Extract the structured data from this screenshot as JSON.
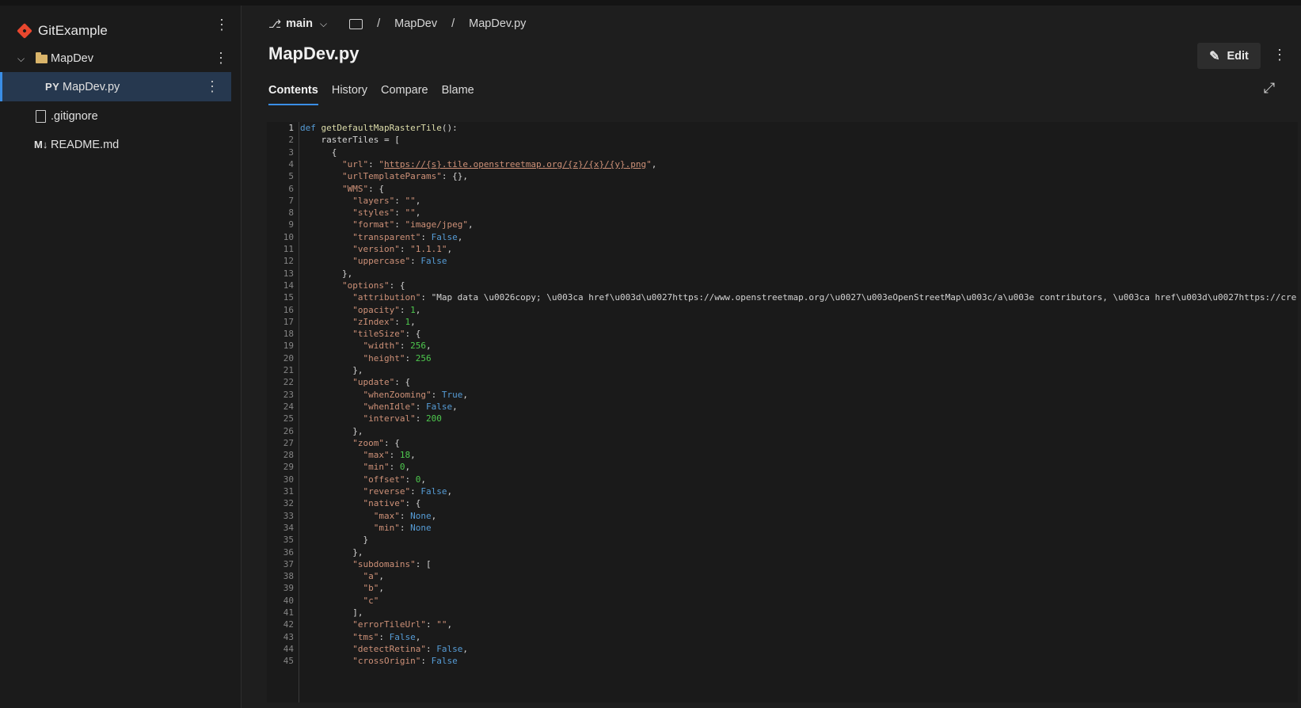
{
  "sidebar": {
    "repo_name": "GitExample",
    "folder_label": "MapDev",
    "py_badge": "PY",
    "items": [
      {
        "label": "MapDev.py"
      },
      {
        "label": ".gitignore"
      },
      {
        "label": "README.md",
        "badge": "M↓"
      }
    ]
  },
  "header": {
    "branch": "main",
    "breadcrumb_folder": "MapDev",
    "breadcrumb_file": "MapDev.py",
    "title": "MapDev.py",
    "edit_label": "Edit"
  },
  "tabs": [
    "Contents",
    "History",
    "Compare",
    "Blame"
  ],
  "code_lines": [
    {
      "n": 1,
      "t": "def getDefaultMapRasterTile():"
    },
    {
      "n": 2,
      "t": "    rasterTiles = ["
    },
    {
      "n": 3,
      "t": "      {"
    },
    {
      "n": 4,
      "t": "        \"url\": \"https://{s}.tile.openstreetmap.org/{z}/{x}/{y}.png\","
    },
    {
      "n": 5,
      "t": "        \"urlTemplateParams\": {},"
    },
    {
      "n": 6,
      "t": "        \"WMS\": {"
    },
    {
      "n": 7,
      "t": "          \"layers\": \"\","
    },
    {
      "n": 8,
      "t": "          \"styles\": \"\","
    },
    {
      "n": 9,
      "t": "          \"format\": \"image/jpeg\","
    },
    {
      "n": 10,
      "t": "          \"transparent\": False,"
    },
    {
      "n": 11,
      "t": "          \"version\": \"1.1.1\","
    },
    {
      "n": 12,
      "t": "          \"uppercase\": False"
    },
    {
      "n": 13,
      "t": "        },"
    },
    {
      "n": 14,
      "t": "        \"options\": {"
    },
    {
      "n": 15,
      "t": "          \"attribution\": \"Map data \\u0026copy; \\u003ca href\\u003d\\u0027https://www.openstreetmap.org/\\u0027\\u003eOpenStreetMap\\u003c/a\\u003e contributors, \\u003ca href\\u003d\\u0027https://cre"
    },
    {
      "n": 16,
      "t": "          \"opacity\": 1,"
    },
    {
      "n": 17,
      "t": "          \"zIndex\": 1,"
    },
    {
      "n": 18,
      "t": "          \"tileSize\": {"
    },
    {
      "n": 19,
      "t": "            \"width\": 256,"
    },
    {
      "n": 20,
      "t": "            \"height\": 256"
    },
    {
      "n": 21,
      "t": "          },"
    },
    {
      "n": 22,
      "t": "          \"update\": {"
    },
    {
      "n": 23,
      "t": "            \"whenZooming\": True,"
    },
    {
      "n": 24,
      "t": "            \"whenIdle\": False,"
    },
    {
      "n": 25,
      "t": "            \"interval\": 200"
    },
    {
      "n": 26,
      "t": "          },"
    },
    {
      "n": 27,
      "t": "          \"zoom\": {"
    },
    {
      "n": 28,
      "t": "            \"max\": 18,"
    },
    {
      "n": 29,
      "t": "            \"min\": 0,"
    },
    {
      "n": 30,
      "t": "            \"offset\": 0,"
    },
    {
      "n": 31,
      "t": "            \"reverse\": False,"
    },
    {
      "n": 32,
      "t": "            \"native\": {"
    },
    {
      "n": 33,
      "t": "              \"max\": None,"
    },
    {
      "n": 34,
      "t": "              \"min\": None"
    },
    {
      "n": 35,
      "t": "            }"
    },
    {
      "n": 36,
      "t": "          },"
    },
    {
      "n": 37,
      "t": "          \"subdomains\": ["
    },
    {
      "n": 38,
      "t": "            \"a\","
    },
    {
      "n": 39,
      "t": "            \"b\","
    },
    {
      "n": 40,
      "t": "            \"c\""
    },
    {
      "n": 41,
      "t": "          ],"
    },
    {
      "n": 42,
      "t": "          \"errorTileUrl\": \"\","
    },
    {
      "n": 43,
      "t": "          \"tms\": False,"
    },
    {
      "n": 44,
      "t": "          \"detectRetina\": False,"
    },
    {
      "n": 45,
      "t": "          \"crossOrigin\": False"
    }
  ]
}
